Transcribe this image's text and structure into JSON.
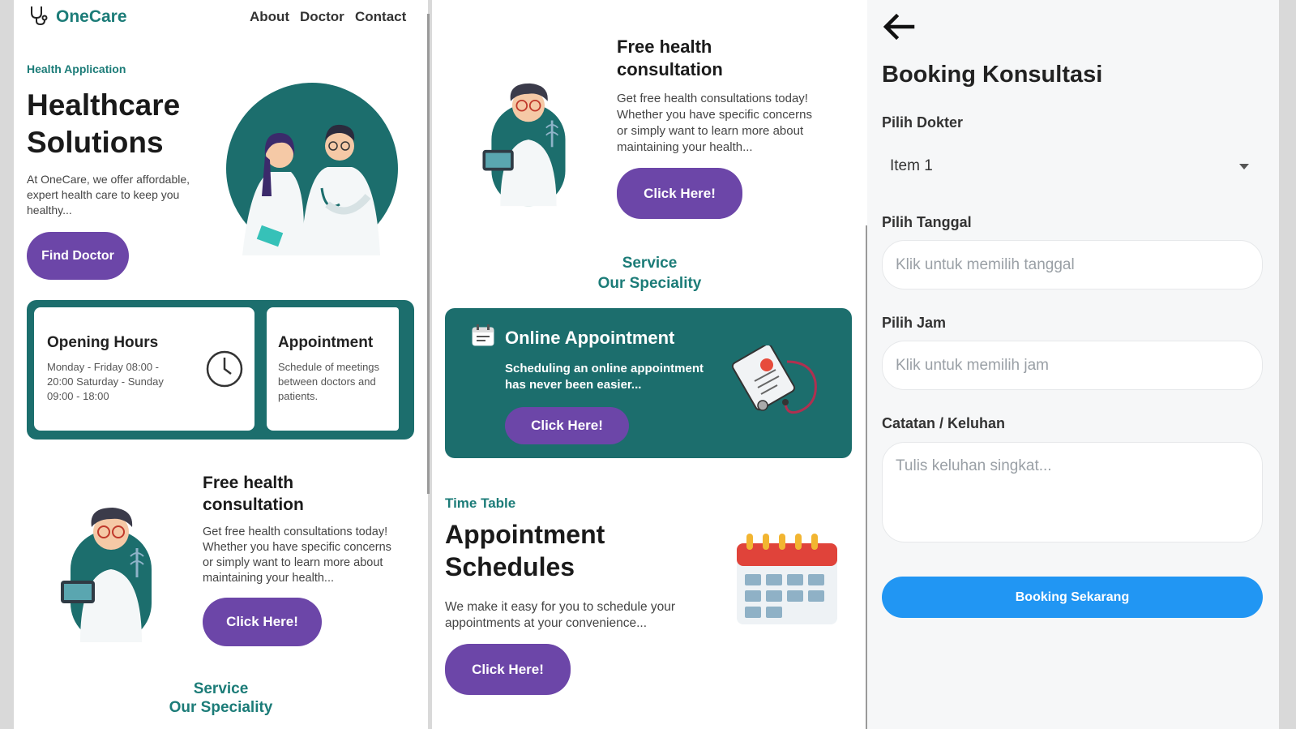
{
  "app": {
    "logo_text": "OneCare",
    "nav": [
      "About",
      "Doctor",
      "Contact"
    ]
  },
  "hero": {
    "eyebrow": "Health Application",
    "title_line1": "Healthcare",
    "title_line2": "Solutions",
    "desc_line1": "At OneCare, we offer affordable,",
    "desc_line2": "expert health care to keep you",
    "desc_line3": "healthy...",
    "cta": "Find Doctor"
  },
  "opening_hours": {
    "title": "Opening Hours",
    "line1": "Monday - Friday 08:00 -",
    "line2": "20:00 Saturday - Sunday",
    "line3": "09:00 - 18:00"
  },
  "appointment_card": {
    "title": "Appointment",
    "line1": "Schedule of meetings",
    "line2": "between doctors and",
    "line3": "patients."
  },
  "free_consult": {
    "title_line1": "Free health",
    "title_line2": "consultation",
    "desc_line1": "Get free health consultations today!",
    "desc_line2": "Whether you have specific concerns",
    "desc_line3": "or simply want to learn more about",
    "desc_line4": "maintaining your health...",
    "cta": "Click Here!"
  },
  "service": {
    "line1": "Service",
    "line2": "Our Speciality"
  },
  "online_appointment": {
    "title": "Online Appointment",
    "desc_line1": "Scheduling an online appointment",
    "desc_line2": "has never been easier...",
    "cta": "Click Here!"
  },
  "timetable": {
    "eyebrow": "Time Table",
    "title_line1": "Appointment",
    "title_line2": "Schedules",
    "desc_line1": "We make it easy for you to schedule your",
    "desc_line2": "appointments at your convenience...",
    "cta": "Click Here!"
  },
  "booking": {
    "title": "Booking Konsultasi",
    "doctor_label": "Pilih Dokter",
    "doctor_value": "Item 1",
    "date_label": "Pilih Tanggal",
    "date_placeholder": "Klik untuk memilih tanggal",
    "time_label": "Pilih Jam",
    "time_placeholder": "Klik untuk memilih jam",
    "notes_label": "Catatan / Keluhan",
    "notes_placeholder": "Tulis keluhan singkat...",
    "submit": "Booking Sekarang"
  },
  "colors": {
    "brand_teal": "#1c7c78",
    "card_teal": "#1c6e6d",
    "button_purple": "#6c46a8",
    "button_blue": "#2196f3"
  }
}
